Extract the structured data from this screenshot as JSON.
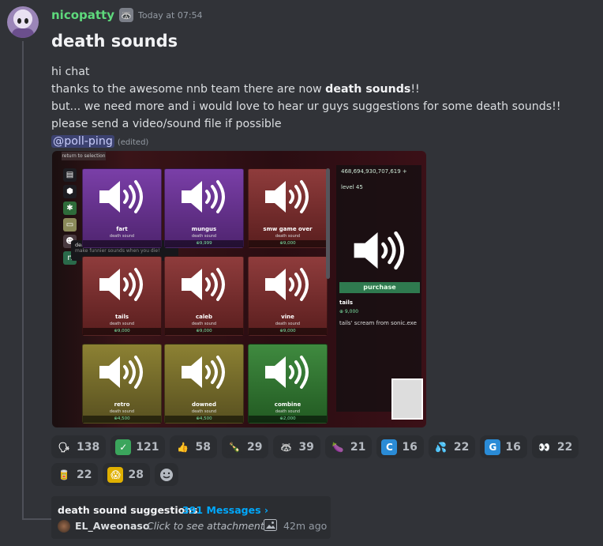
{
  "message": {
    "username": "nicopatty",
    "timestamp": "Today at 07:54",
    "title": "death sounds",
    "lines": {
      "l1": "hi chat",
      "l2_pre": "thanks to the awesome nnb team there are now ",
      "l2_bold": "death sounds",
      "l2_post": "!!",
      "l3": "but... we need more and i would love to hear ur guys suggestions for some death sounds!!",
      "l4": "please send a video/sound file if possible"
    },
    "mention": "@poll-ping",
    "edited": "(edited)"
  },
  "game": {
    "tab": "return to selection",
    "tooltip_title": "death",
    "tooltip_desc": "make funnier sounds when you die!",
    "cards": [
      {
        "name": "fart",
        "sub": "death sound",
        "price": ""
      },
      {
        "name": "mungus",
        "sub": "death sound",
        "price": "⊕9,999"
      },
      {
        "name": "smw game over",
        "sub": "death sound",
        "price": "⊕9,000"
      },
      {
        "name": "tails",
        "sub": "death sound",
        "price": "⊕9,000"
      },
      {
        "name": "caleb",
        "sub": "death sound",
        "price": "⊕9,000"
      },
      {
        "name": "vine",
        "sub": "death sound",
        "price": "⊕9,000"
      },
      {
        "name": "retro",
        "sub": "death sound",
        "price": "⊕4,500"
      },
      {
        "name": "downed",
        "sub": "death sound",
        "price": "⊕4,500"
      },
      {
        "name": "combine",
        "sub": "death sound",
        "price": "⊕2,000"
      }
    ],
    "money": "468,694,930,707,619 +",
    "level": "level 45",
    "purchase": "purchase",
    "selected_name": "tails",
    "selected_price": "⊕ 9,000",
    "selected_desc": "tails' scream from sonic.exe"
  },
  "reactions": [
    {
      "emoji": "🗣",
      "count": "138",
      "bg": "#2b2d31"
    },
    {
      "emoji": "✓",
      "count": "121",
      "bg": "#3ba55c"
    },
    {
      "emoji": "👍",
      "count": "58",
      "bg": "#2b2d31"
    },
    {
      "emoji": "🍾",
      "count": "29",
      "bg": "#2b2d31"
    },
    {
      "emoji": "🦝",
      "count": "39",
      "bg": "#2b2d31"
    },
    {
      "emoji": "🍆",
      "count": "21",
      "bg": "#2b2d31"
    },
    {
      "emoji": "C",
      "count": "16",
      "bg": "#2a8bd6"
    },
    {
      "emoji": "💦",
      "count": "22",
      "bg": "#2b2d31"
    },
    {
      "emoji": "G",
      "count": "16",
      "bg": "#2a8bd6"
    },
    {
      "emoji": "👀",
      "count": "22",
      "bg": "#2b2d31"
    },
    {
      "emoji": "🥫",
      "count": "22",
      "bg": "#2b2d31"
    },
    {
      "emoji": "😱",
      "count": "28",
      "bg": "#e0b000"
    }
  ],
  "thread": {
    "name": "death sound suggestions",
    "count": "391 Messages ›",
    "last_user": "EL_Aweonaso",
    "last_msg": "Click to see attachment",
    "time": "42m ago"
  }
}
